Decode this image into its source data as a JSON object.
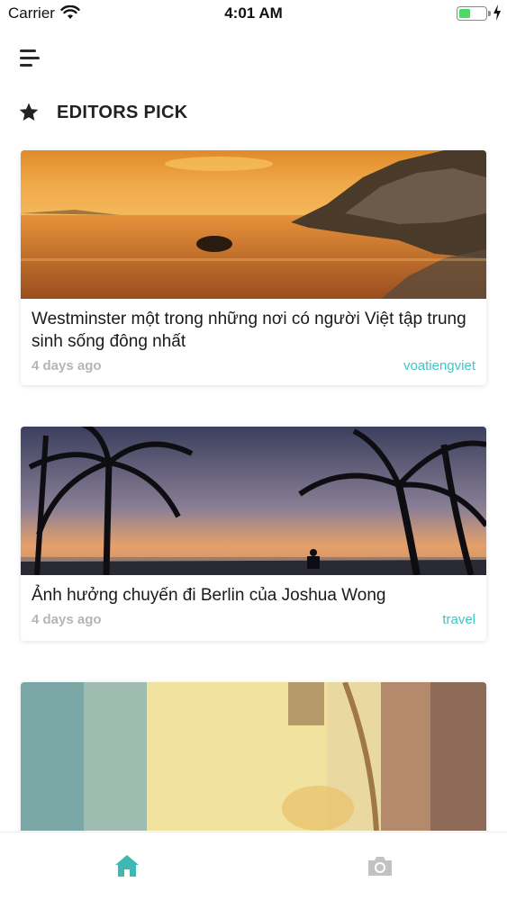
{
  "status_bar": {
    "carrier": "Carrier",
    "time": "4:01 AM",
    "battery_level": 0.45,
    "battery_color": "#4cd964"
  },
  "header": {
    "menu_icon": "menu-icon",
    "section_icon": "star-icon",
    "section_title": "EDITORS PICK"
  },
  "articles": [
    {
      "title": "Westminster một trong những nơi có người Việt tập trung sinh sống đông nhất",
      "date": "4 days ago",
      "tag": "voatiengviet",
      "image": "sunset-sea-rocks"
    },
    {
      "title": "Ảnh hưởng chuyến đi Berlin của Joshua Wong",
      "date": "4 days ago",
      "tag": "travel",
      "image": "palm-trees-sunset"
    },
    {
      "title": "",
      "date": "",
      "tag": "",
      "image": "painted-wall"
    }
  ],
  "tab_bar": {
    "tabs": [
      {
        "icon": "home-icon",
        "active": true
      },
      {
        "icon": "camera-icon",
        "active": false
      }
    ],
    "active_color": "#3fb8b3",
    "inactive_color": "#c2c2c2"
  },
  "colors": {
    "tag": "#3fc6c4",
    "date": "#b5b5b5"
  }
}
